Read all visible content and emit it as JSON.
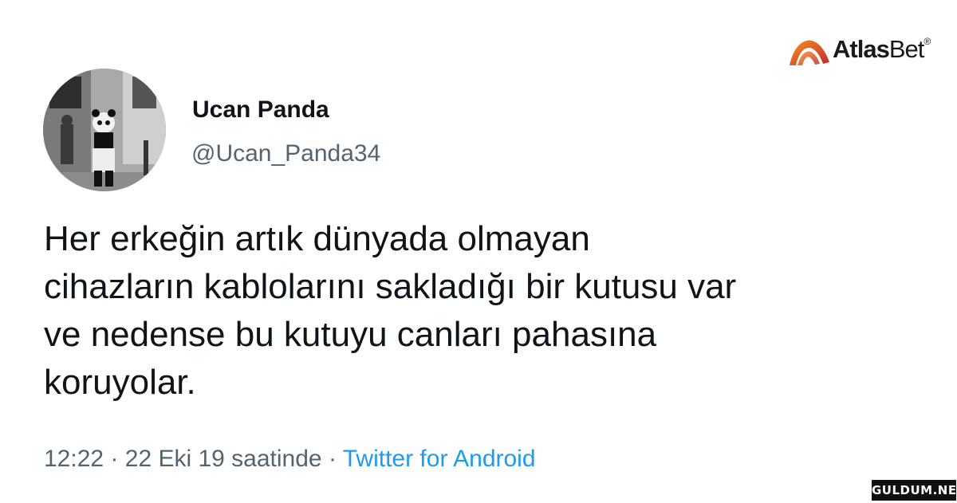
{
  "tweet": {
    "author_name": "Ucan Panda",
    "author_handle": "@Ucan_Panda34",
    "text_lines": [
      "Her erkeğin artık dünyada olmayan",
      "cihazların kablolarını sakladığı bir kutusu var",
      "ve nedense bu kutuyu canları pahasına",
      "koruyolar."
    ],
    "time": "12:22",
    "separator": "·",
    "date": "22 Eki 19 saatinde",
    "source": "Twitter for Android"
  },
  "branding": {
    "logo_text_bold": "Atlas",
    "logo_text_light": "Bet",
    "logo_mark": "®",
    "watermark_text": "GULDUM.NET"
  },
  "colors": {
    "text": "#0f1419",
    "secondary_text": "#536471",
    "link": "#1d9bf0",
    "logo_gradient_start": "#f7931e",
    "logo_gradient_end": "#c1272d"
  },
  "icons": {
    "avatar": "panda-costume-photo",
    "logo": "atlasbet-arc-logo"
  }
}
